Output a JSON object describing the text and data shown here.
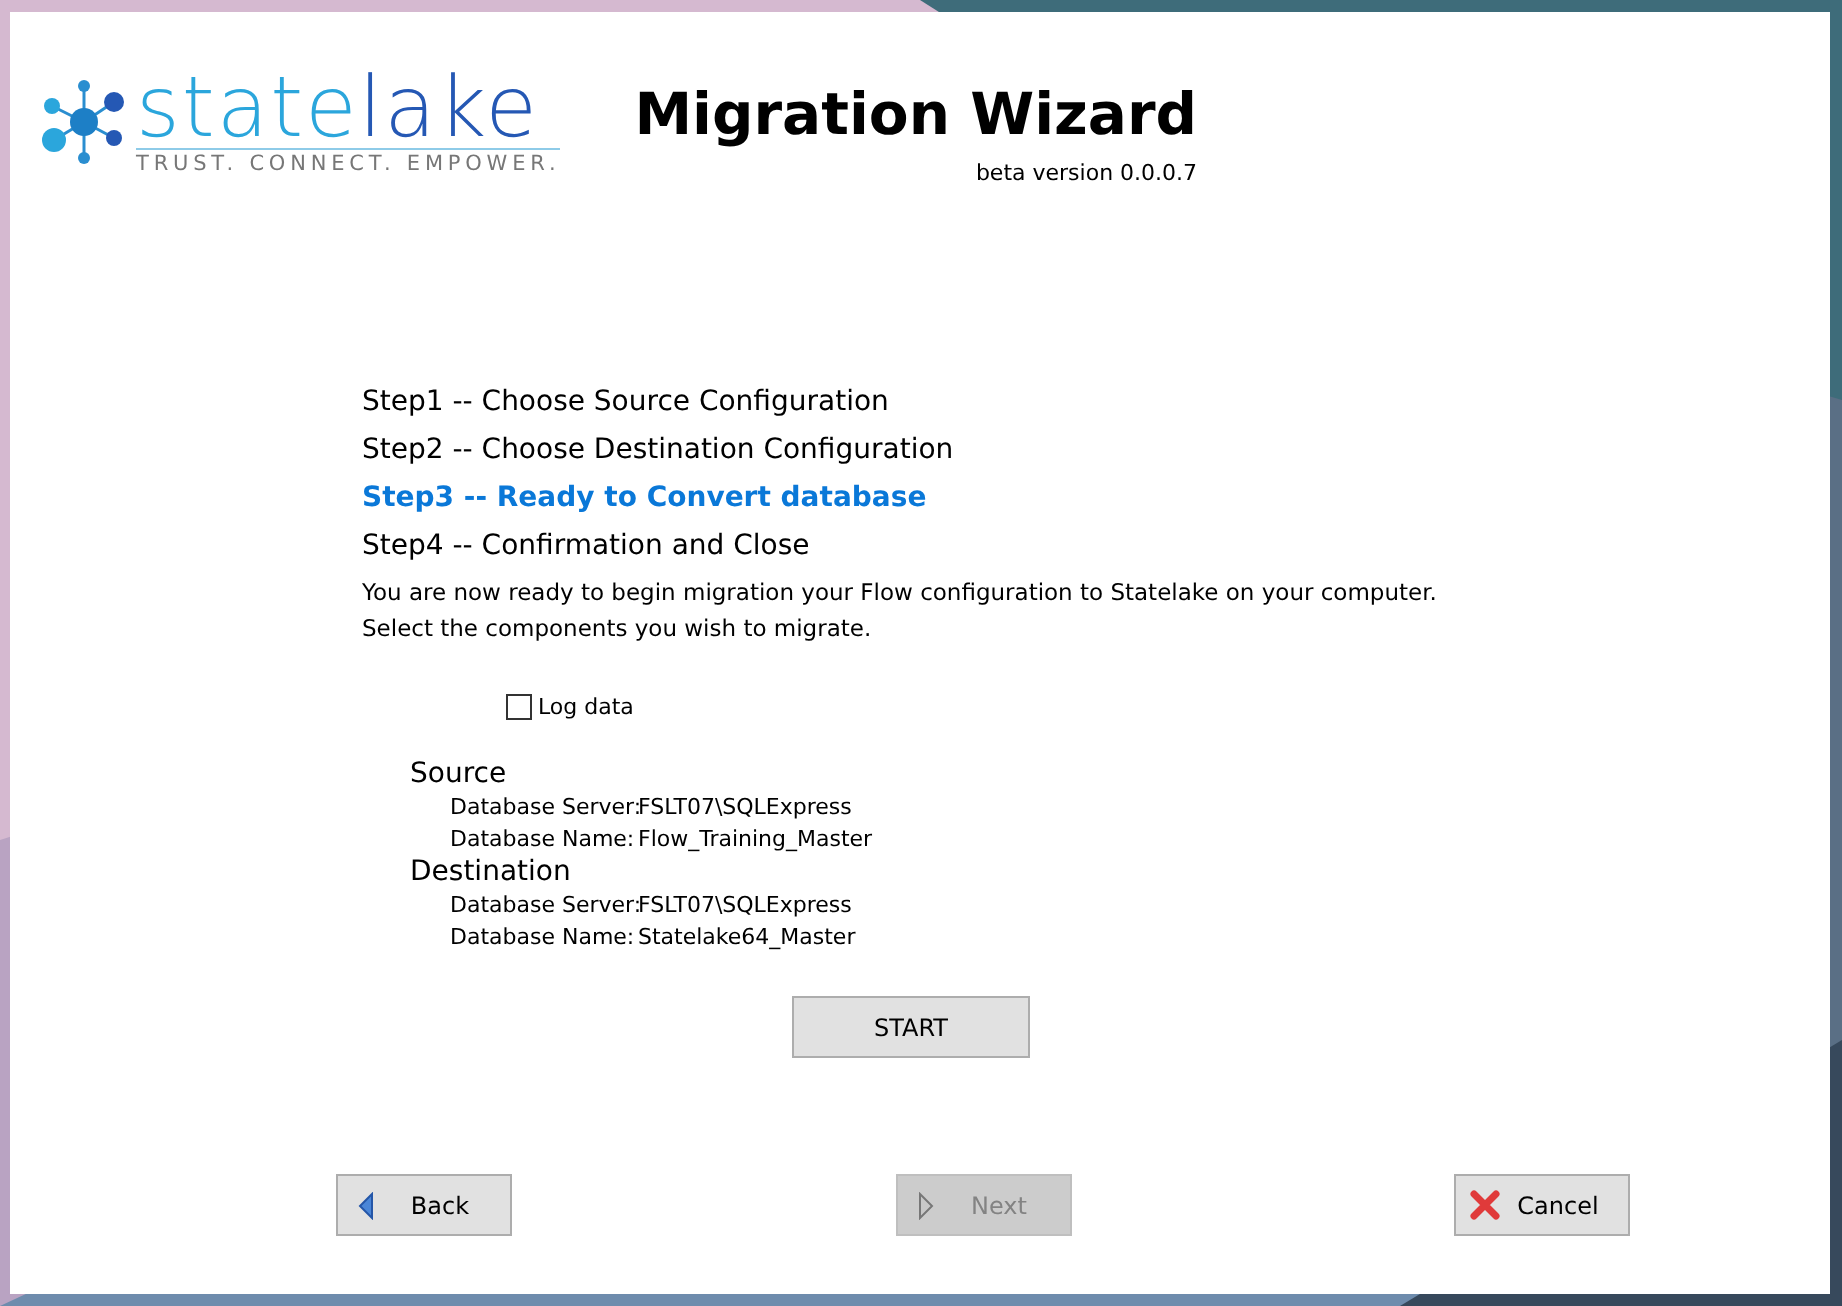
{
  "logo": {
    "word_1": "state",
    "word_2": "lake",
    "tagline": "TRUST. CONNECT. EMPOWER."
  },
  "title": "Migration Wizard",
  "version": "beta version 0.0.0.7",
  "steps": [
    {
      "label": "Step1 -- Choose Source Configuration",
      "selected": false
    },
    {
      "label": "Step2 -- Choose Destination Configuration",
      "selected": false
    },
    {
      "label": "Step3 -- Ready to Convert database",
      "selected": true
    },
    {
      "label": "Step4 -- Confirmation and Close",
      "selected": false
    }
  ],
  "description": [
    "You are now ready to begin migration your Flow configuration to Statelake on your computer.",
    "Select the components you wish to migrate."
  ],
  "log_data": {
    "label": "Log data",
    "checked": false
  },
  "sections": [
    {
      "heading": "Source",
      "fields": [
        {
          "label": "Database Server:",
          "value": "FSLT07\\SQLExpress"
        },
        {
          "label": "Database Name:",
          "value": "Flow_Training_Master"
        }
      ]
    },
    {
      "heading": "Destination",
      "fields": [
        {
          "label": "Database Server:",
          "value": "FSLT07\\SQLExpress"
        },
        {
          "label": "Database Name:",
          "value": "Statelake64_Master"
        }
      ]
    }
  ],
  "start_button": {
    "label": "START"
  },
  "nav_buttons": [
    {
      "kind": "back",
      "label": "Back",
      "disabled": false
    },
    {
      "kind": "next",
      "label": "Next",
      "disabled": true
    },
    {
      "kind": "cancel",
      "label": "Cancel",
      "disabled": false
    }
  ]
}
